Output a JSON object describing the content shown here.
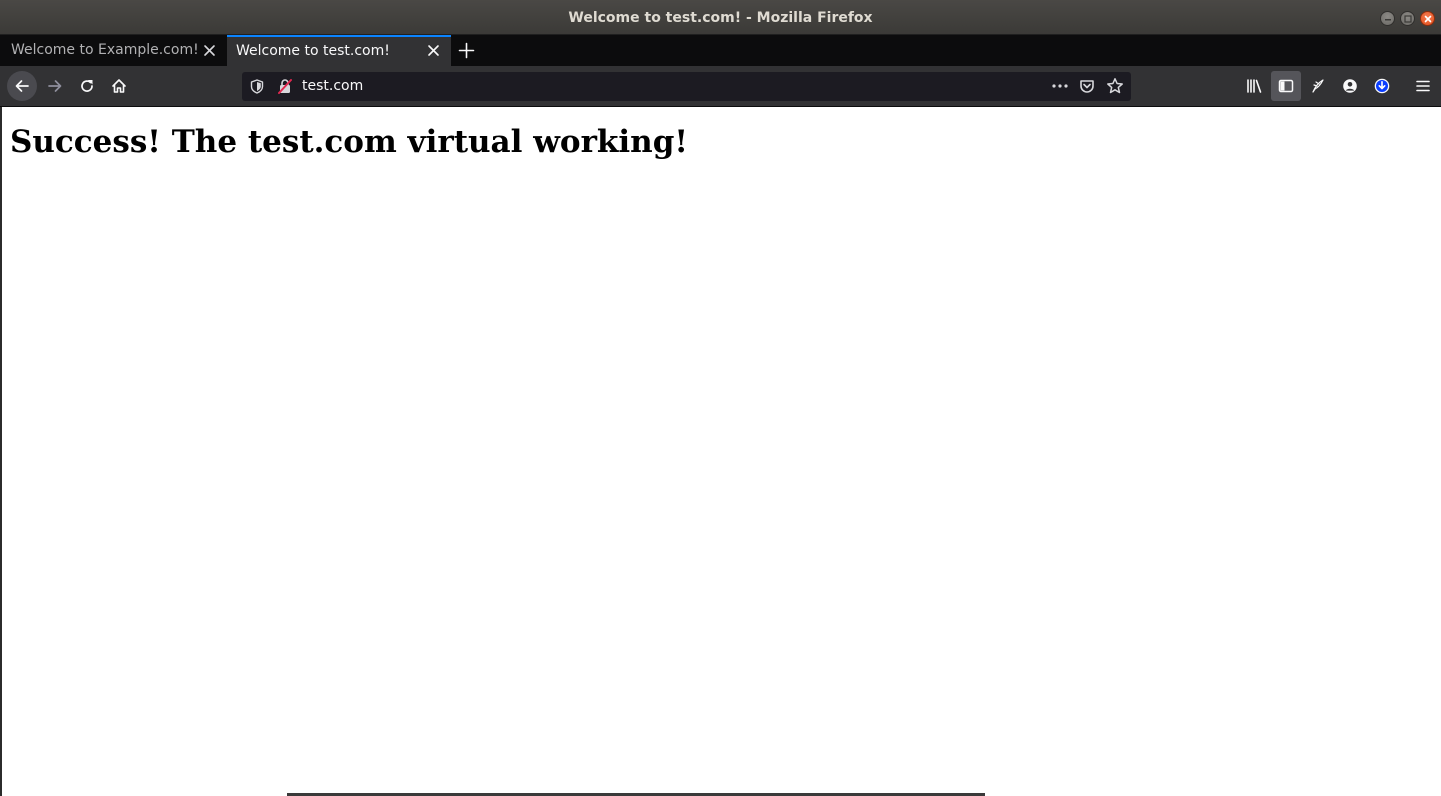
{
  "window": {
    "title": "Welcome to test.com! - Mozilla Firefox",
    "controls": [
      "minimize-icon",
      "maximize-icon",
      "close-icon"
    ],
    "close_color": "#e95420"
  },
  "tabs": [
    {
      "label": "Welcome to Example.com!",
      "active": false
    },
    {
      "label": "Welcome to test.com!",
      "active": true
    }
  ],
  "toolbar": {
    "nav_icons": [
      "back-arrow-icon",
      "forward-arrow-icon",
      "reload-icon",
      "home-icon"
    ],
    "urlbar": {
      "value": "test.com",
      "icons": [
        "shield-icon",
        "insecure-lock-icon",
        "more-actions-icon",
        "pocket-icon",
        "bookmark-star-icon"
      ]
    },
    "right_icons": [
      "library-icon",
      "sidebar-icon",
      "extension-icon",
      "account-icon",
      "download-icon",
      "hamburger-menu-icon"
    ]
  },
  "page": {
    "heading": "Success! The test.com virtual working!"
  },
  "colors": {
    "titlebar": "#3c3b37",
    "tabstrip": "#0c0c0d",
    "active_tab": "#323234",
    "active_tab_accent": "#0a84ff",
    "urlbar": "#1c1b22",
    "download_badge": "#0a3dff"
  }
}
